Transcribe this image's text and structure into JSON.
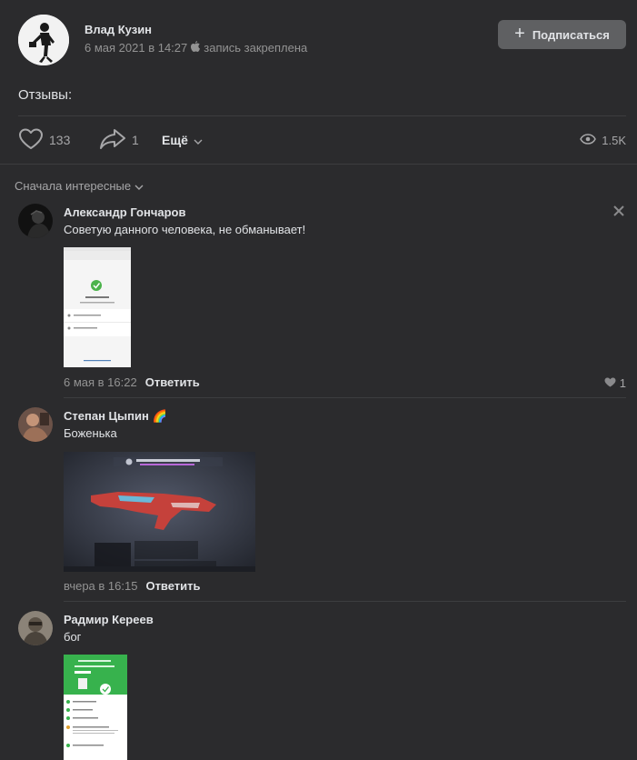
{
  "post": {
    "author": "Влад Кузин",
    "date": "6 мая 2021 в 14:27",
    "pinned": "запись закреплена",
    "subscribe_label": "Подписаться",
    "text": "Отзывы:"
  },
  "actions": {
    "likes": "133",
    "shares": "1",
    "more_label": "Ещё",
    "views": "1.5K"
  },
  "sort_label": "Сначала интересные",
  "comments": [
    {
      "author": "Александр Гончаров",
      "text": "Советую данного человека, не обманывает!",
      "date": "6 мая в 16:22",
      "reply": "Ответить",
      "likes": "1"
    },
    {
      "author": "Степан Цыпин",
      "emoji": "🌈",
      "text": "Боженька",
      "date": "вчера в 16:15",
      "reply": "Ответить"
    },
    {
      "author": "Радмир Кереев",
      "text": "бог"
    }
  ],
  "colors": {
    "background": "#2b2b2d",
    "divider": "#3c3d3f",
    "button": "#5f6062",
    "text": "#e1e3e6",
    "muted": "#939393"
  }
}
